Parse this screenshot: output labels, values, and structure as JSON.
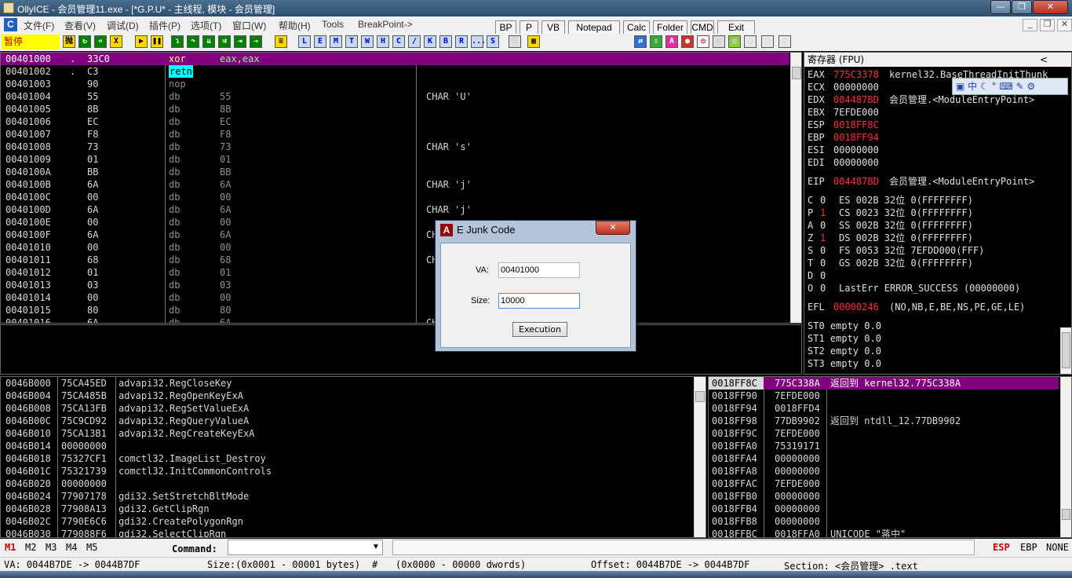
{
  "window": {
    "title": "OllyICE - 会员管理11.exe - [*G.P.U* - 主线程, 模块 - 会员管理]",
    "min": "—",
    "max": "❐",
    "close": "✕"
  },
  "menu": {
    "items": [
      "文件(F)",
      "查看(V)",
      "调试(D)",
      "插件(P)",
      "选项(T)",
      "窗口(W)",
      "帮助(H)",
      "Tools",
      "BreakPoint->"
    ],
    "buttons": [
      "BP",
      "P",
      "VB",
      "Notepad",
      "Calc",
      "Folder",
      "CMD",
      "Exit"
    ]
  },
  "toolbar": {
    "status": "暂停",
    "letters": [
      "L",
      "E",
      "M",
      "T",
      "W",
      "H",
      "C",
      "/",
      "K",
      "B",
      "R",
      "...",
      "S"
    ]
  },
  "disasm": {
    "rows": [
      {
        "addr": "00401000",
        "mark": ".",
        "hex": "33C0",
        "op": "xor",
        "args": "eax,eax",
        "cmt": ""
      },
      {
        "addr": "00401002",
        "mark": ".",
        "hex": "C3",
        "op": "retn",
        "args": "",
        "cmt": ""
      },
      {
        "addr": "00401003",
        "mark": "",
        "hex": "90",
        "op": "nop",
        "args": "",
        "cmt": ""
      },
      {
        "addr": "00401004",
        "mark": "",
        "hex": "55",
        "op": "db",
        "args": "55",
        "cmt": "CHAR 'U'"
      },
      {
        "addr": "00401005",
        "mark": "",
        "hex": "8B",
        "op": "db",
        "args": "8B",
        "cmt": ""
      },
      {
        "addr": "00401006",
        "mark": "",
        "hex": "EC",
        "op": "db",
        "args": "EC",
        "cmt": ""
      },
      {
        "addr": "00401007",
        "mark": "",
        "hex": "F8",
        "op": "db",
        "args": "F8",
        "cmt": ""
      },
      {
        "addr": "00401008",
        "mark": "",
        "hex": "73",
        "op": "db",
        "args": "73",
        "cmt": "CHAR 's'"
      },
      {
        "addr": "00401009",
        "mark": "",
        "hex": "01",
        "op": "db",
        "args": "01",
        "cmt": ""
      },
      {
        "addr": "0040100A",
        "mark": "",
        "hex": "BB",
        "op": "db",
        "args": "BB",
        "cmt": ""
      },
      {
        "addr": "0040100B",
        "mark": "",
        "hex": "6A",
        "op": "db",
        "args": "6A",
        "cmt": "CHAR 'j'"
      },
      {
        "addr": "0040100C",
        "mark": "",
        "hex": "00",
        "op": "db",
        "args": "00",
        "cmt": ""
      },
      {
        "addr": "0040100D",
        "mark": "",
        "hex": "6A",
        "op": "db",
        "args": "6A",
        "cmt": "CHAR 'j'"
      },
      {
        "addr": "0040100E",
        "mark": "",
        "hex": "00",
        "op": "db",
        "args": "00",
        "cmt": ""
      },
      {
        "addr": "0040100F",
        "mark": "",
        "hex": "6A",
        "op": "db",
        "args": "6A",
        "cmt": "CH"
      },
      {
        "addr": "00401010",
        "mark": "",
        "hex": "00",
        "op": "db",
        "args": "00",
        "cmt": ""
      },
      {
        "addr": "00401011",
        "mark": "",
        "hex": "68",
        "op": "db",
        "args": "68",
        "cmt": "CH"
      },
      {
        "addr": "00401012",
        "mark": "",
        "hex": "01",
        "op": "db",
        "args": "01",
        "cmt": ""
      },
      {
        "addr": "00401013",
        "mark": "",
        "hex": "03",
        "op": "db",
        "args": "03",
        "cmt": ""
      },
      {
        "addr": "00401014",
        "mark": "",
        "hex": "00",
        "op": "db",
        "args": "00",
        "cmt": ""
      },
      {
        "addr": "00401015",
        "mark": "",
        "hex": "80",
        "op": "db",
        "args": "80",
        "cmt": ""
      },
      {
        "addr": "00401016",
        "mark": "",
        "hex": "6A",
        "op": "db",
        "args": "6A",
        "cmt": "CH"
      }
    ]
  },
  "registers": {
    "header": "寄存器 (FPU)",
    "collapse": "<",
    "gp": [
      {
        "name": "EAX",
        "val": "775C3378",
        "red": true,
        "info": "kernel32.BaseThreadInitThunk"
      },
      {
        "name": "ECX",
        "val": "00000000",
        "red": false,
        "info": ""
      },
      {
        "name": "EDX",
        "val": "004487BD",
        "red": true,
        "info": "会员管理.<ModuleEntryPoint>"
      },
      {
        "name": "EBX",
        "val": "7EFDE000",
        "red": false,
        "info": ""
      },
      {
        "name": "ESP",
        "val": "0018FF8C",
        "red": true,
        "info": ""
      },
      {
        "name": "EBP",
        "val": "0018FF94",
        "red": true,
        "info": ""
      },
      {
        "name": "ESI",
        "val": "00000000",
        "red": false,
        "info": ""
      },
      {
        "name": "EDI",
        "val": "00000000",
        "red": false,
        "info": ""
      }
    ],
    "eip": {
      "name": "EIP",
      "val": "004487BD",
      "info": "会员管理.<ModuleEntryPoint>"
    },
    "flags": [
      {
        "f": "C",
        "v": "0",
        "red": false,
        "rest": "ES 002B 32位 0(FFFFFFFF)"
      },
      {
        "f": "P",
        "v": "1",
        "red": true,
        "rest": "CS 0023 32位 0(FFFFFFFF)"
      },
      {
        "f": "A",
        "v": "0",
        "red": false,
        "rest": "SS 002B 32位 0(FFFFFFFF)"
      },
      {
        "f": "Z",
        "v": "1",
        "red": true,
        "rest": "DS 002B 32位 0(FFFFFFFF)"
      },
      {
        "f": "S",
        "v": "0",
        "red": false,
        "rest": "FS 0053 32位 7EFDD000(FFF)"
      },
      {
        "f": "T",
        "v": "0",
        "red": false,
        "rest": "GS 002B 32位 0(FFFFFFFF)"
      },
      {
        "f": "D",
        "v": "0",
        "red": false,
        "rest": ""
      },
      {
        "f": "O",
        "v": "0",
        "red": false,
        "rest": "LastErr ERROR_SUCCESS (00000000)"
      }
    ],
    "efl": {
      "name": "EFL",
      "val": "00000246",
      "info": "(NO,NB,E,BE,NS,PE,GE,LE)"
    },
    "fpu": [
      "ST0 empty 0.0",
      "ST1 empty 0.0",
      "ST2 empty 0.0",
      "ST3 empty 0.0"
    ],
    "ime": "中"
  },
  "dump": {
    "rows": [
      {
        "addr": "0046B000",
        "val": "75CA45ED",
        "txt": "advapi32.RegCloseKey"
      },
      {
        "addr": "0046B004",
        "val": "75CA485B",
        "txt": "advapi32.RegOpenKeyExA"
      },
      {
        "addr": "0046B008",
        "val": "75CA13FB",
        "txt": "advapi32.RegSetValueExA"
      },
      {
        "addr": "0046B00C",
        "val": "75C9CD92",
        "txt": "advapi32.RegQueryValueA"
      },
      {
        "addr": "0046B010",
        "val": "75CA13B1",
        "txt": "advapi32.RegCreateKeyExA"
      },
      {
        "addr": "0046B014",
        "val": "00000000",
        "txt": ""
      },
      {
        "addr": "0046B018",
        "val": "75327CF1",
        "txt": "comctl32.ImageList_Destroy"
      },
      {
        "addr": "0046B01C",
        "val": "75321739",
        "txt": "comctl32.InitCommonControls"
      },
      {
        "addr": "0046B020",
        "val": "00000000",
        "txt": ""
      },
      {
        "addr": "0046B024",
        "val": "77907178",
        "txt": "gdi32.SetStretchBltMode"
      },
      {
        "addr": "0046B028",
        "val": "77908A13",
        "txt": "gdi32.GetClipRgn"
      },
      {
        "addr": "0046B02C",
        "val": "7790E6C6",
        "txt": "gdi32.CreatePolygonRgn"
      },
      {
        "addr": "0046B030",
        "val": "779088F6",
        "txt": "gdi32.SelectClipRgn"
      }
    ]
  },
  "stack": {
    "rows": [
      {
        "addr": "0018FF8C",
        "val": "775C338A",
        "txt": "返回到 kernel32.775C338A"
      },
      {
        "addr": "0018FF90",
        "val": "7EFDE000",
        "txt": ""
      },
      {
        "addr": "0018FF94",
        "val": "0018FFD4",
        "txt": ""
      },
      {
        "addr": "0018FF98",
        "val": "77DB9902",
        "txt": "返回到 ntdll_12.77DB9902"
      },
      {
        "addr": "0018FF9C",
        "val": "7EFDE000",
        "txt": ""
      },
      {
        "addr": "0018FFA0",
        "val": "75319171",
        "txt": ""
      },
      {
        "addr": "0018FFA4",
        "val": "00000000",
        "txt": ""
      },
      {
        "addr": "0018FFA8",
        "val": "00000000",
        "txt": ""
      },
      {
        "addr": "0018FFAC",
        "val": "7EFDE000",
        "txt": ""
      },
      {
        "addr": "0018FFB0",
        "val": "00000000",
        "txt": ""
      },
      {
        "addr": "0018FFB4",
        "val": "00000000",
        "txt": ""
      },
      {
        "addr": "0018FFB8",
        "val": "00000000",
        "txt": ""
      },
      {
        "addr": "0018FFBC",
        "val": "0018FFA0",
        "txt": "UNICODE \"蒋中\""
      }
    ]
  },
  "dialog": {
    "title": "E Junk Code",
    "va_label": "VA:",
    "va_value": "00401000",
    "size_label": "Size:",
    "size_value": "10000",
    "exec": "Execution",
    "close": "✕"
  },
  "command": {
    "tabs": [
      "M1",
      "M2",
      "M3",
      "M4",
      "M5"
    ],
    "label": "Command:",
    "value": "",
    "regs": [
      "ESP",
      "EBP",
      "NONE"
    ]
  },
  "status": {
    "va": "VA: 0044B7DE -> 0044B7DF",
    "size": "Size:(0x0001 - 00001 bytes)",
    "hash": "#",
    "dwords": "(0x0000 - 00000 dwords)",
    "offset": "Offset: 0044B7DE -> 0044B7DF",
    "section": "Section: <会员管理> .text"
  },
  "colors": {
    "select": "#800080",
    "red": "#ff3030",
    "cyan": "#00ffff",
    "yellow": "#ffff00"
  }
}
